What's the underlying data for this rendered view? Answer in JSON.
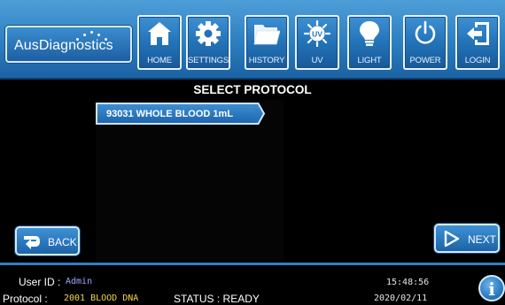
{
  "brand": {
    "name": "AusDiagnostics"
  },
  "toolbar": {
    "buttons": [
      {
        "label": "HOME",
        "icon": "home-icon"
      },
      {
        "label": "SETTINGS",
        "icon": "gear-icon"
      },
      {
        "label": "HISTORY",
        "icon": "folder-icon"
      },
      {
        "label": "UV",
        "icon": "uv-icon"
      },
      {
        "label": "LIGHT",
        "icon": "lightbulb-icon"
      },
      {
        "label": "POWER",
        "icon": "power-icon"
      },
      {
        "label": "LOGIN",
        "icon": "login-icon"
      }
    ]
  },
  "main": {
    "title": "SELECT PROTOCOL",
    "protocols": [
      {
        "label": "93031 WHOLE BLOOD 1mL"
      }
    ],
    "back_label": "BACK",
    "next_label": "NEXT"
  },
  "footer": {
    "user_id_label": "User ID :",
    "user_id_value": "Admin",
    "protocol_label": "Protocol :",
    "protocol_value": "2001 BLOOD DNA",
    "status_label": "STATUS : READY",
    "time": "15:48:56",
    "date": "2020/02/11",
    "info_glyph": "i"
  },
  "colors": {
    "header_blue": "#2c7fc0",
    "button_border": "#e8f2fb",
    "footer_accent": "#2f7fc2",
    "value_yellow": "#f0d64a"
  }
}
